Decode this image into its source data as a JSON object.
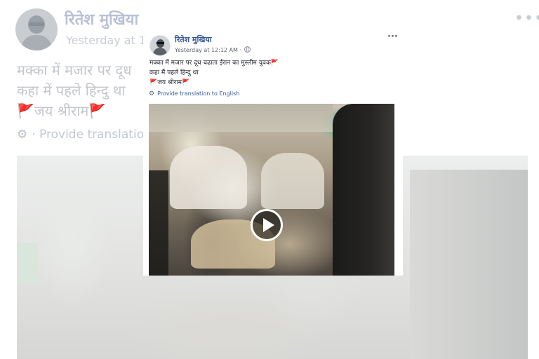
{
  "background_post": {
    "author_name": "रितेश मुखिया",
    "timestamp": "Yesterday at 1",
    "text_lines": "मक्का में मजार पर दूध\nकहा में पहले हिन्दु था\n🚩जय श्रीराम🚩",
    "translate_label": "· Provide translation",
    "menu_icon": "more-options-icon"
  },
  "post": {
    "author_name": "रितेश मुखिया",
    "timestamp": "Yesterday at 12:12 AM ·",
    "text": "मक्का में मजार पर दूध चढाता ईरान का मुस्लीम युवक🚩\nकहा मैं पहले हिन्दु था\n🚩जय श्रीराम🚩",
    "translate_label": "Provide translation to English",
    "menu_icon": "more-options-icon",
    "video": {
      "play_icon": "play-icon"
    }
  },
  "colors": {
    "author_link": "#365899",
    "body_text": "#1d2129",
    "meta_text": "#616770"
  }
}
